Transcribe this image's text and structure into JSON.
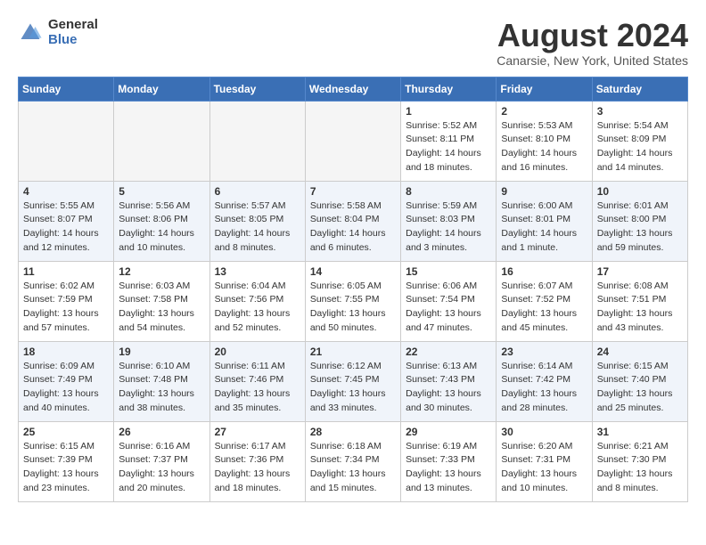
{
  "header": {
    "logo_general": "General",
    "logo_blue": "Blue",
    "month_title": "August 2024",
    "location": "Canarsie, New York, United States"
  },
  "days_of_week": [
    "Sunday",
    "Monday",
    "Tuesday",
    "Wednesday",
    "Thursday",
    "Friday",
    "Saturday"
  ],
  "weeks": [
    [
      {
        "day": "",
        "empty": true
      },
      {
        "day": "",
        "empty": true
      },
      {
        "day": "",
        "empty": true
      },
      {
        "day": "",
        "empty": true
      },
      {
        "day": "1",
        "sunrise": "5:52 AM",
        "sunset": "8:11 PM",
        "daylight": "14 hours and 18 minutes."
      },
      {
        "day": "2",
        "sunrise": "5:53 AM",
        "sunset": "8:10 PM",
        "daylight": "14 hours and 16 minutes."
      },
      {
        "day": "3",
        "sunrise": "5:54 AM",
        "sunset": "8:09 PM",
        "daylight": "14 hours and 14 minutes."
      }
    ],
    [
      {
        "day": "4",
        "sunrise": "5:55 AM",
        "sunset": "8:07 PM",
        "daylight": "14 hours and 12 minutes."
      },
      {
        "day": "5",
        "sunrise": "5:56 AM",
        "sunset": "8:06 PM",
        "daylight": "14 hours and 10 minutes."
      },
      {
        "day": "6",
        "sunrise": "5:57 AM",
        "sunset": "8:05 PM",
        "daylight": "14 hours and 8 minutes."
      },
      {
        "day": "7",
        "sunrise": "5:58 AM",
        "sunset": "8:04 PM",
        "daylight": "14 hours and 6 minutes."
      },
      {
        "day": "8",
        "sunrise": "5:59 AM",
        "sunset": "8:03 PM",
        "daylight": "14 hours and 3 minutes."
      },
      {
        "day": "9",
        "sunrise": "6:00 AM",
        "sunset": "8:01 PM",
        "daylight": "14 hours and 1 minute."
      },
      {
        "day": "10",
        "sunrise": "6:01 AM",
        "sunset": "8:00 PM",
        "daylight": "13 hours and 59 minutes."
      }
    ],
    [
      {
        "day": "11",
        "sunrise": "6:02 AM",
        "sunset": "7:59 PM",
        "daylight": "13 hours and 57 minutes."
      },
      {
        "day": "12",
        "sunrise": "6:03 AM",
        "sunset": "7:58 PM",
        "daylight": "13 hours and 54 minutes."
      },
      {
        "day": "13",
        "sunrise": "6:04 AM",
        "sunset": "7:56 PM",
        "daylight": "13 hours and 52 minutes."
      },
      {
        "day": "14",
        "sunrise": "6:05 AM",
        "sunset": "7:55 PM",
        "daylight": "13 hours and 50 minutes."
      },
      {
        "day": "15",
        "sunrise": "6:06 AM",
        "sunset": "7:54 PM",
        "daylight": "13 hours and 47 minutes."
      },
      {
        "day": "16",
        "sunrise": "6:07 AM",
        "sunset": "7:52 PM",
        "daylight": "13 hours and 45 minutes."
      },
      {
        "day": "17",
        "sunrise": "6:08 AM",
        "sunset": "7:51 PM",
        "daylight": "13 hours and 43 minutes."
      }
    ],
    [
      {
        "day": "18",
        "sunrise": "6:09 AM",
        "sunset": "7:49 PM",
        "daylight": "13 hours and 40 minutes."
      },
      {
        "day": "19",
        "sunrise": "6:10 AM",
        "sunset": "7:48 PM",
        "daylight": "13 hours and 38 minutes."
      },
      {
        "day": "20",
        "sunrise": "6:11 AM",
        "sunset": "7:46 PM",
        "daylight": "13 hours and 35 minutes."
      },
      {
        "day": "21",
        "sunrise": "6:12 AM",
        "sunset": "7:45 PM",
        "daylight": "13 hours and 33 minutes."
      },
      {
        "day": "22",
        "sunrise": "6:13 AM",
        "sunset": "7:43 PM",
        "daylight": "13 hours and 30 minutes."
      },
      {
        "day": "23",
        "sunrise": "6:14 AM",
        "sunset": "7:42 PM",
        "daylight": "13 hours and 28 minutes."
      },
      {
        "day": "24",
        "sunrise": "6:15 AM",
        "sunset": "7:40 PM",
        "daylight": "13 hours and 25 minutes."
      }
    ],
    [
      {
        "day": "25",
        "sunrise": "6:15 AM",
        "sunset": "7:39 PM",
        "daylight": "13 hours and 23 minutes."
      },
      {
        "day": "26",
        "sunrise": "6:16 AM",
        "sunset": "7:37 PM",
        "daylight": "13 hours and 20 minutes."
      },
      {
        "day": "27",
        "sunrise": "6:17 AM",
        "sunset": "7:36 PM",
        "daylight": "13 hours and 18 minutes."
      },
      {
        "day": "28",
        "sunrise": "6:18 AM",
        "sunset": "7:34 PM",
        "daylight": "13 hours and 15 minutes."
      },
      {
        "day": "29",
        "sunrise": "6:19 AM",
        "sunset": "7:33 PM",
        "daylight": "13 hours and 13 minutes."
      },
      {
        "day": "30",
        "sunrise": "6:20 AM",
        "sunset": "7:31 PM",
        "daylight": "13 hours and 10 minutes."
      },
      {
        "day": "31",
        "sunrise": "6:21 AM",
        "sunset": "7:30 PM",
        "daylight": "13 hours and 8 minutes."
      }
    ]
  ],
  "labels": {
    "sunrise": "Sunrise:",
    "sunset": "Sunset:",
    "daylight": "Daylight:"
  }
}
